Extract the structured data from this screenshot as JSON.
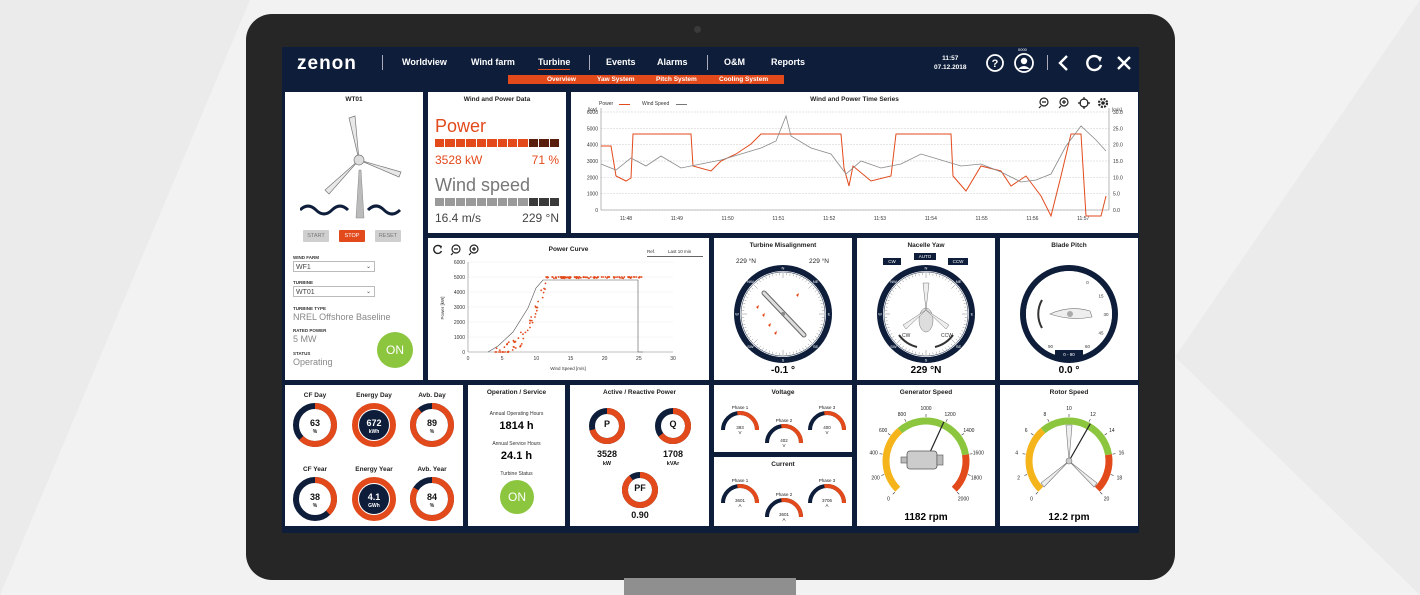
{
  "app": {
    "logo": "zenon",
    "time": "11:57",
    "date": "07.12.2018",
    "user_code": "0000"
  },
  "nav": {
    "items": [
      "Worldview",
      "Wind farm",
      "Turbine",
      "Events",
      "Alarms",
      "O&M",
      "Reports"
    ],
    "active": "Turbine",
    "subnav": [
      "Overview",
      "Yaw System",
      "Pitch System",
      "Cooling System"
    ]
  },
  "turbine_panel": {
    "title": "WT01",
    "buttons": [
      "START",
      "STOP",
      "RESET"
    ],
    "wind_farm_label": "WIND FARM",
    "wind_farm_value": "WF1",
    "turbine_label": "TURBINE",
    "turbine_value": "WT01",
    "type_label": "TURBINE TYPE",
    "type_value": "NREL Offshore Baseline",
    "rated_label": "RATED POWER",
    "rated_value": "5 MW",
    "status_label": "STATUS",
    "status_value": "Operating",
    "on_label": "ON"
  },
  "wind_power_data": {
    "title": "Wind and Power Data",
    "power_label": "Power",
    "power_kw": "3528 kW",
    "power_pct": "71 %",
    "power_fill": 0.71,
    "wind_label": "Wind speed",
    "wind_speed": "16.4 m/s",
    "wind_dir": "229 °N",
    "wind_fill": 0.75
  },
  "timeseries": {
    "title": "Wind and Power Time Series",
    "legend_power": "Power",
    "legend_wind": "Wind Speed",
    "left_unit": "[kW]",
    "right_unit": "[m/s]",
    "left_ticks": [
      "6000",
      "5000",
      "4000",
      "3000",
      "2000",
      "1000",
      "0"
    ],
    "right_ticks": [
      "30.0",
      "25.0",
      "20.0",
      "15.0",
      "10.0",
      "5.0",
      "0.0"
    ],
    "x_ticks": [
      "11:48",
      "11:49",
      "11:50",
      "11:51",
      "11:52",
      "11:53",
      "11:54",
      "11:55",
      "11:56",
      "11:57"
    ]
  },
  "power_curve": {
    "title": "Power Curve",
    "ref": "Ref.",
    "range": "Last 10 min",
    "xlabel": "Wind Speed [m/s]",
    "ylabel": "Power [kW]",
    "x_ticks": [
      "0",
      "5",
      "10",
      "15",
      "20",
      "25",
      "30"
    ],
    "y_ticks": [
      "6000",
      "5000",
      "4000",
      "3000",
      "2000",
      "1000",
      "0"
    ]
  },
  "misalignment": {
    "title": "Turbine Misalignment",
    "dir1": "229 °N",
    "dir2": "229 °N",
    "value": "-0.1 °"
  },
  "nacelle_yaw": {
    "title": "Nacelle Yaw",
    "btn_cw": "CW",
    "btn_auto": "AUTO",
    "btn_ccw": "CCW",
    "value": "229 °N",
    "cw": "CW",
    "ccw": "CCW"
  },
  "blade_pitch": {
    "title": "Blade Pitch",
    "value": "0.0 °",
    "range": "0 - 90"
  },
  "kpis": [
    {
      "label": "CF Day",
      "value": "63",
      "unit": "%",
      "fill": 0.63,
      "dark": false
    },
    {
      "label": "Energy Day",
      "value": "672",
      "unit": "kWh",
      "fill": 1.0,
      "dark": true
    },
    {
      "label": "Avb. Day",
      "value": "89",
      "unit": "%",
      "fill": 0.89,
      "dark": false
    },
    {
      "label": "CF Year",
      "value": "38",
      "unit": "%",
      "fill": 0.38,
      "dark": false
    },
    {
      "label": "Energy Year",
      "value": "4.1",
      "unit": "GWh",
      "fill": 1.0,
      "dark": true
    },
    {
      "label": "Avb. Year",
      "value": "84",
      "unit": "%",
      "fill": 0.84,
      "dark": false
    }
  ],
  "operation": {
    "title": "Operation / Service",
    "op_hours_label": "Annual Operating Hours",
    "op_hours": "1814 h",
    "svc_hours_label": "Annual Service Hours",
    "svc_hours": "24.1 h",
    "status_label": "Turbine Status",
    "status": "ON"
  },
  "active_reactive": {
    "title": "Active / Reactive Power",
    "p_label": "P",
    "p_value": "3528",
    "p_unit": "kW",
    "p_fill": 0.71,
    "q_label": "Q",
    "q_value": "1708",
    "q_unit": "kVAr",
    "q_fill": 0.65,
    "pf_label": "PF",
    "pf_value": "0.90",
    "pf_fill": 0.9
  },
  "voltage": {
    "title": "Voltage",
    "phases": [
      {
        "label": "Phase 1",
        "value": "393",
        "unit": "V"
      },
      {
        "label": "Phase 2",
        "value": "402",
        "unit": "V"
      },
      {
        "label": "Phase 3",
        "value": "400",
        "unit": "V"
      }
    ]
  },
  "current": {
    "title": "Current",
    "phases": [
      {
        "label": "Phase 1",
        "value": "3601",
        "unit": "A"
      },
      {
        "label": "Phase 2",
        "value": "3601",
        "unit": "A"
      },
      {
        "label": "Phase 3",
        "value": "3706",
        "unit": "A"
      }
    ]
  },
  "generator_speed": {
    "title": "Generator Speed",
    "value": "1182 rpm",
    "ticks": [
      "0",
      "200",
      "400",
      "600",
      "800",
      "1000",
      "1200",
      "1400",
      "1600",
      "1800",
      "2000"
    ],
    "reading": 1182,
    "max": 2000
  },
  "rotor_speed": {
    "title": "Rotor Speed",
    "value": "12.2 rpm",
    "ticks": [
      "0",
      "2",
      "4",
      "6",
      "8",
      "10",
      "12",
      "14",
      "16",
      "18",
      "20"
    ],
    "reading": 12.2,
    "max": 20
  },
  "colors": {
    "accent": "#e24a1c",
    "navy": "#0d1d3a",
    "green": "#8cc63f",
    "yellow": "#f4b41a"
  }
}
